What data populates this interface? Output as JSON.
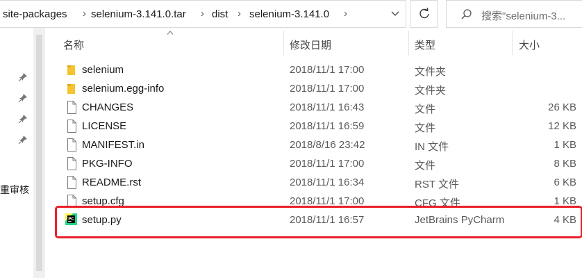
{
  "address": {
    "crumbs": [
      "site-packages",
      "selenium-3.141.0.tar",
      "dist",
      "selenium-3.141.0"
    ],
    "separators": [
      "›",
      "›",
      "›",
      "›"
    ]
  },
  "search": {
    "placeholder": "搜索\"selenium-3..."
  },
  "nav": {
    "partial_label": "重审核"
  },
  "columns": {
    "name": "名称",
    "date": "修改日期",
    "type": "类型",
    "size": "大小"
  },
  "files": [
    {
      "name": "selenium",
      "date": "2018/11/1 17:00",
      "type": "文件夹",
      "size": "",
      "icon": "folder-icon"
    },
    {
      "name": "selenium.egg-info",
      "date": "2018/11/1 17:00",
      "type": "文件夹",
      "size": "",
      "icon": "folder-icon"
    },
    {
      "name": "CHANGES",
      "date": "2018/11/1 16:43",
      "type": "文件",
      "size": "26 KB",
      "icon": "file-icon"
    },
    {
      "name": "LICENSE",
      "date": "2018/11/1 16:59",
      "type": "文件",
      "size": "12 KB",
      "icon": "file-icon"
    },
    {
      "name": "MANIFEST.in",
      "date": "2018/8/16 23:42",
      "type": "IN 文件",
      "size": "1 KB",
      "icon": "file-icon"
    },
    {
      "name": "PKG-INFO",
      "date": "2018/11/1 17:00",
      "type": "文件",
      "size": "8 KB",
      "icon": "file-icon"
    },
    {
      "name": "README.rst",
      "date": "2018/11/1 16:34",
      "type": "RST 文件",
      "size": "6 KB",
      "icon": "file-icon"
    },
    {
      "name": "setup.cfg",
      "date": "2018/11/1 17:00",
      "type": "CFG 文件",
      "size": "1 KB",
      "icon": "file-icon"
    },
    {
      "name": "setup.py",
      "date": "2018/11/1 16:57",
      "type": "JetBrains PyCharm",
      "size": "4 KB",
      "icon": "pycharm-icon"
    }
  ],
  "colors": {
    "highlight": "#e8202a",
    "folder": "#f4c430"
  }
}
